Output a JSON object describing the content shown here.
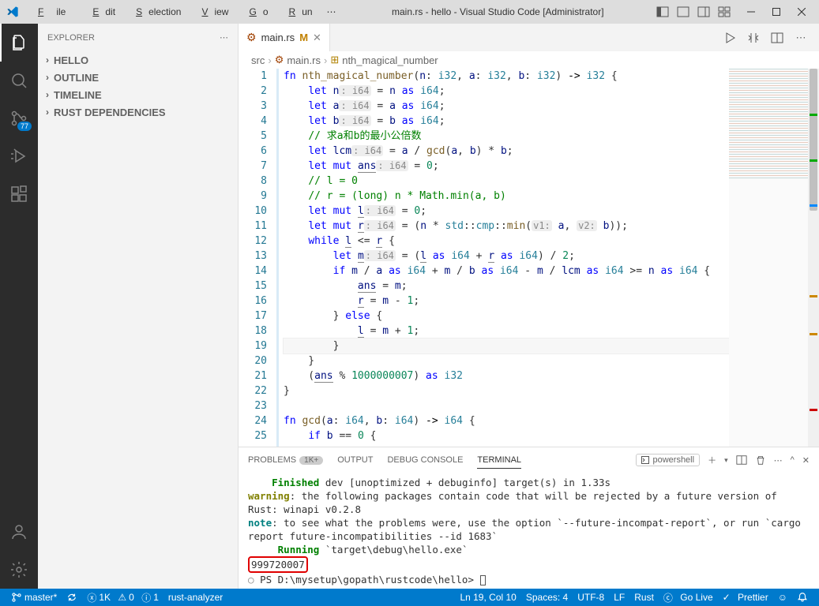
{
  "title": "main.rs - hello - Visual Studio Code [Administrator]",
  "menu": {
    "file": "File",
    "edit": "Edit",
    "selection": "Selection",
    "view": "View",
    "go": "Go",
    "run": "Run",
    "more": "⋯"
  },
  "activity": {
    "scm_badge": "77"
  },
  "sidebar": {
    "title": "EXPLORER",
    "sections": {
      "hello": "HELLO",
      "outline": "OUTLINE",
      "timeline": "TIMELINE",
      "rustdeps": "RUST DEPENDENCIES"
    }
  },
  "tab": {
    "filename": "main.rs",
    "modified": "M"
  },
  "breadcrumbs": {
    "src": "src",
    "file": "main.rs",
    "symbol": "nth_magical_number"
  },
  "code": {
    "lines": [
      {
        "n": 1,
        "html": "<span class='kw'>fn</span> <span class='fn'>nth_magical_number</span>(<span class='vr'>n</span>: <span class='ty'>i32</span>, <span class='vr'>a</span>: <span class='ty'>i32</span>, <span class='vr'>b</span>: <span class='ty'>i32</span>) <span class='op'>-&gt;</span> <span class='ty'>i32</span> {"
      },
      {
        "n": 2,
        "html": "    <span class='kw'>let</span> <span class='vr'>n</span><span class='hint'>: i64</span> = <span class='vr'>n</span> <span class='kw'>as</span> <span class='ty'>i64</span>;"
      },
      {
        "n": 3,
        "html": "    <span class='kw'>let</span> <span class='vr'>a</span><span class='hint'>: i64</span> = <span class='vr'>a</span> <span class='kw'>as</span> <span class='ty'>i64</span>;"
      },
      {
        "n": 4,
        "html": "    <span class='kw'>let</span> <span class='vr'>b</span><span class='hint'>: i64</span> = <span class='vr'>b</span> <span class='kw'>as</span> <span class='ty'>i64</span>;"
      },
      {
        "n": 5,
        "html": "    <span class='cm'>// 求a和b的最小公倍数</span>"
      },
      {
        "n": 6,
        "html": "    <span class='kw'>let</span> <span class='vr'>lcm</span><span class='hint'>: i64</span> = <span class='vr'>a</span> / <span class='fn'>gcd</span>(<span class='vr'>a</span>, <span class='vr'>b</span>) * <span class='vr'>b</span>;"
      },
      {
        "n": 7,
        "html": "    <span class='kw'>let</span> <span class='kw'>mut</span> <span class='vr ul'>ans</span><span class='hint'>: i64</span> = <span class='nm'>0</span>;"
      },
      {
        "n": 8,
        "html": "    <span class='cm'>// l = 0</span>"
      },
      {
        "n": 9,
        "html": "    <span class='cm'>// r = (long) n * Math.min(a, b)</span>"
      },
      {
        "n": 10,
        "html": "    <span class='kw'>let</span> <span class='kw'>mut</span> <span class='vr ul'>l</span><span class='hint'>: i64</span> = <span class='nm'>0</span>;"
      },
      {
        "n": 11,
        "html": "    <span class='kw'>let</span> <span class='kw'>mut</span> <span class='vr ul'>r</span><span class='hint'>: i64</span> = (<span class='vr'>n</span> * <span class='ty'>std</span>::<span class='ty'>cmp</span>::<span class='fn'>min</span>(<span class='hint'>v1:</span> <span class='vr'>a</span>, <span class='hint'>v2:</span> <span class='vr'>b</span>));"
      },
      {
        "n": 12,
        "html": "    <span class='kw'>while</span> <span class='vr ul'>l</span> &lt;= <span class='vr ul'>r</span> {"
      },
      {
        "n": 13,
        "html": "        <span class='kw'>let</span> <span class='vr ul'>m</span><span class='hint'>: i64</span> = (<span class='vr ul'>l</span> <span class='kw'>as</span> <span class='ty'>i64</span> + <span class='vr ul'>r</span> <span class='kw'>as</span> <span class='ty'>i64</span>) / <span class='nm'>2</span>;"
      },
      {
        "n": 14,
        "html": "        <span class='kw'>if</span> <span class='vr'>m</span> / <span class='vr'>a</span> <span class='kw'>as</span> <span class='ty'>i64</span> + <span class='vr'>m</span> / <span class='vr'>b</span> <span class='kw'>as</span> <span class='ty'>i64</span> - <span class='vr'>m</span> / <span class='vr'>lcm</span> <span class='kw'>as</span> <span class='ty'>i64</span> &gt;= <span class='vr'>n</span> <span class='kw'>as</span> <span class='ty'>i64</span> {"
      },
      {
        "n": 15,
        "html": "            <span class='vr ul'>ans</span> = <span class='vr'>m</span>;"
      },
      {
        "n": 16,
        "html": "            <span class='vr ul'>r</span> = <span class='vr'>m</span> - <span class='nm'>1</span>;"
      },
      {
        "n": 17,
        "html": "        } <span class='kw'>else</span> {"
      },
      {
        "n": 18,
        "html": "            <span class='vr ul'>l</span> = <span class='vr'>m</span> + <span class='nm'>1</span>;"
      },
      {
        "n": 19,
        "html": "        }",
        "current": true
      },
      {
        "n": 20,
        "html": "    }"
      },
      {
        "n": 21,
        "html": "    (<span class='vr ul'>ans</span> % <span class='nm'>1000000007</span>) <span class='kw'>as</span> <span class='ty'>i32</span>"
      },
      {
        "n": 22,
        "html": "}"
      },
      {
        "n": 23,
        "html": ""
      },
      {
        "n": 24,
        "html": "<span class='kw'>fn</span> <span class='fn'>gcd</span>(<span class='vr'>a</span>: <span class='ty'>i64</span>, <span class='vr'>b</span>: <span class='ty'>i64</span>) <span class='op'>-&gt;</span> <span class='ty'>i64</span> {"
      },
      {
        "n": 25,
        "html": "    <span class='kw'>if</span> <span class='vr'>b</span> == <span class='nm'>0</span> {"
      }
    ]
  },
  "panel": {
    "tabs": {
      "problems": "PROBLEMS",
      "problems_badge": "1K+",
      "output": "OUTPUT",
      "debug": "DEBUG CONSOLE",
      "terminal": "TERMINAL"
    },
    "shell": "powershell",
    "term": {
      "l1a": "Finished",
      "l1b": " dev [unoptimized + debuginfo] target(s) in 1.33s",
      "l2a": "warning",
      "l2b": ": the following packages contain code that will be rejected by a future version of Rust: winapi v0.2.8",
      "l3a": "note",
      "l3b": ": to see what the problems were, use the option `--future-incompat-report`, or run `cargo report future-incompatibilities --id 1683`",
      "l4a": "Running",
      "l4b": " `target\\debug\\hello.exe`",
      "l5": "999720007",
      "l6a": "PS ",
      "l6b": "D:\\mysetup\\gopath\\rustcode\\hello",
      "l6c": "> "
    }
  },
  "status": {
    "branch": "master*",
    "sync": "⟲",
    "errors": "1K",
    "warnings": "0",
    "info": "1",
    "rust_analyzer": "rust-analyzer",
    "ln": "Ln 19, Col 10",
    "spaces": "Spaces: 4",
    "encoding": "UTF-8",
    "eol": "LF",
    "lang": "Rust",
    "golive": "Go Live",
    "prettier": "Prettier"
  }
}
